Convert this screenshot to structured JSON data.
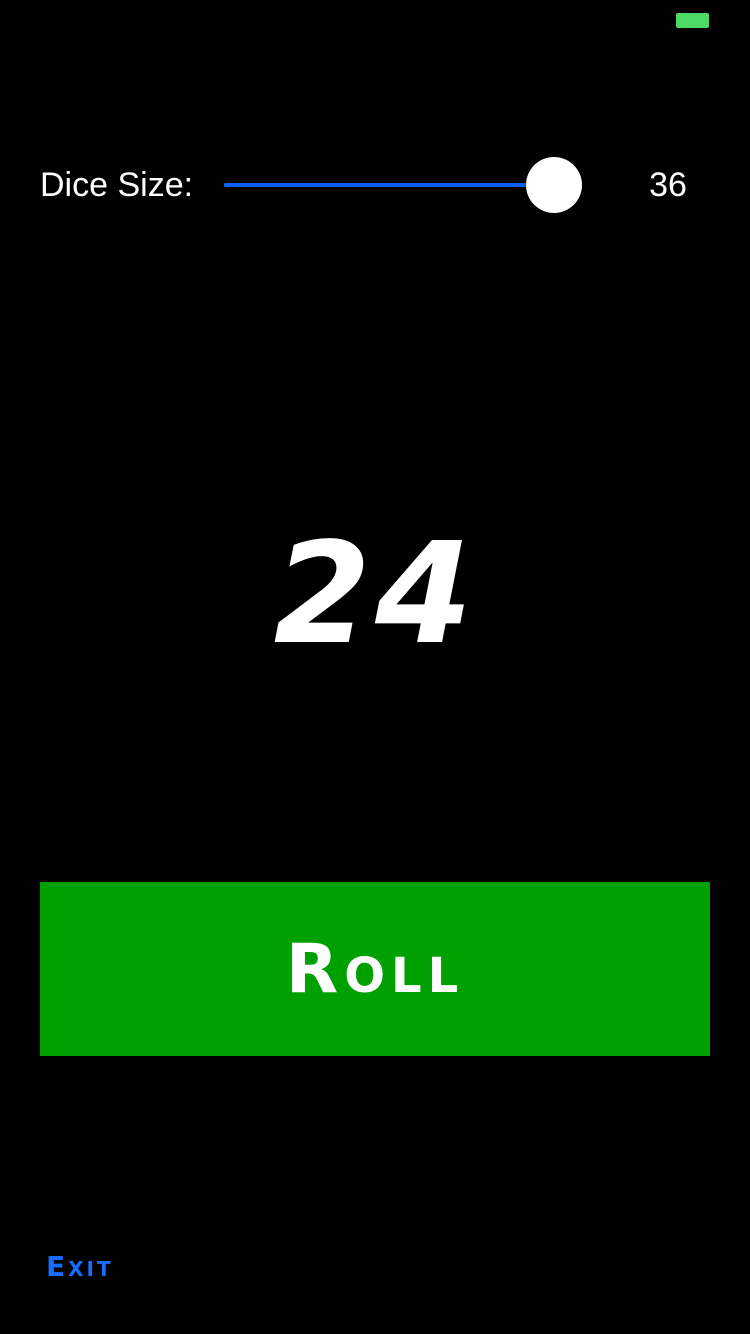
{
  "colors": {
    "background": "#000000",
    "battery": "#4cd964",
    "slider_accent": "#0a60ff",
    "button": "#00a000",
    "exit_link": "#1a6bff"
  },
  "settings": {
    "dice_size_label": "Dice Size:",
    "dice_size_value": "36",
    "slider_fraction": 0.92
  },
  "result": {
    "value": "24"
  },
  "roll_button": {
    "label": "Roll"
  },
  "exit": {
    "label": "Exit"
  }
}
